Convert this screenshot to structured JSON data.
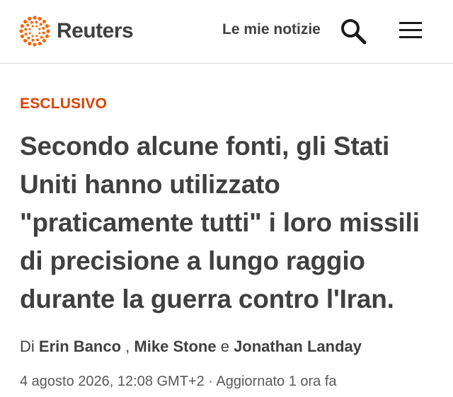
{
  "header": {
    "brand": "Reuters",
    "my_news_label": "Le mie notizie",
    "search_icon": "search-icon",
    "menu_icon": "hamburger-menu-icon",
    "brand_color": "#fa6400"
  },
  "article": {
    "section_tag": "ESCLUSIVO",
    "section_color": "#dc4300",
    "headline": "Secondo alcune fonti, gli Stati Uniti hanno utilizzato \"praticamente tutti\" i loro missili di precisione a lungo raggio durante la guerra contro l'Iran.",
    "byline": {
      "prefix": "Di",
      "authors": [
        "Erin Banco",
        "Mike Stone",
        "Jonathan Landay"
      ],
      "separator": ",",
      "conjunction": "e"
    },
    "dateline": "4 agosto 2026, 12:08 GMT+2 · Aggiornato 1 ora fa"
  }
}
